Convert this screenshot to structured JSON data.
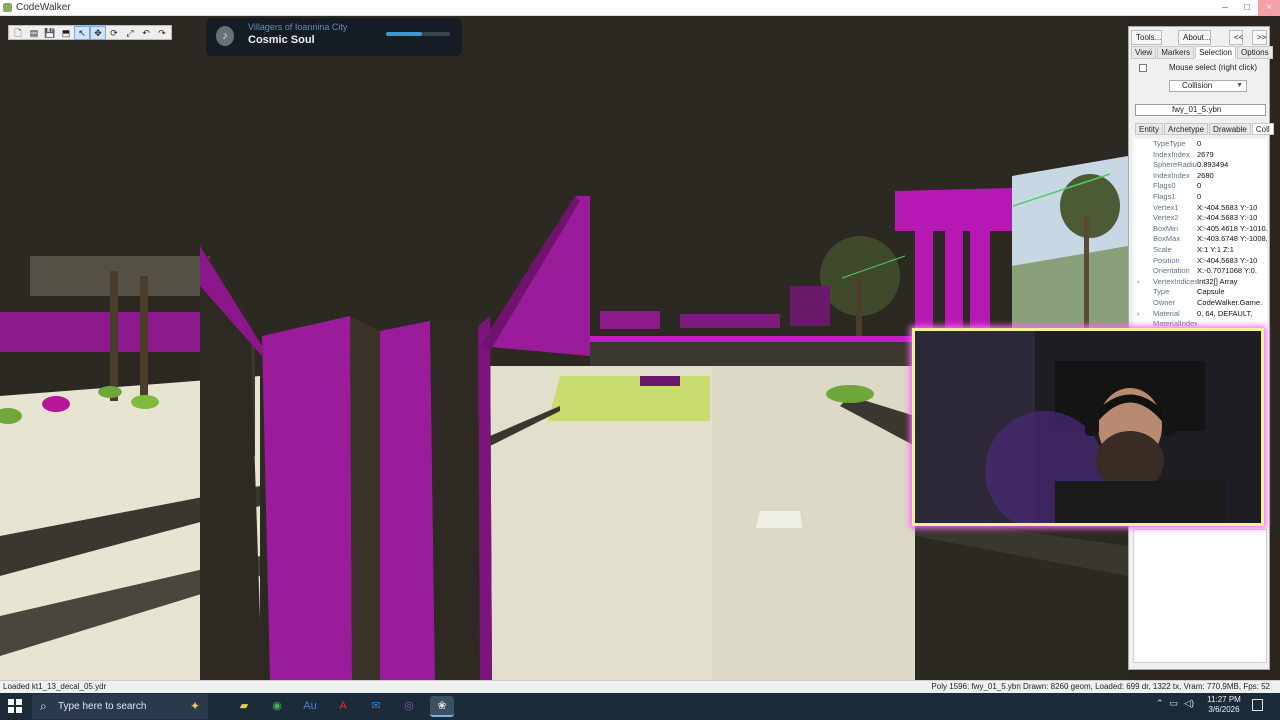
{
  "window": {
    "title": "CodeWalker",
    "controls": [
      "–",
      "□",
      "×"
    ]
  },
  "toolbar": {
    "buttons": [
      {
        "name": "new-button",
        "glyph": "🗋"
      },
      {
        "name": "open-button",
        "glyph": "▤"
      },
      {
        "name": "save-button",
        "glyph": "💾"
      },
      {
        "name": "save-all-button",
        "glyph": "⬒"
      },
      {
        "name": "select-tool-button",
        "glyph": "↖"
      },
      {
        "name": "move-tool-button",
        "glyph": "✥"
      },
      {
        "name": "rotate-tool-button",
        "glyph": "⟳"
      },
      {
        "name": "scale-tool-button",
        "glyph": "⤢"
      },
      {
        "name": "undo-button",
        "glyph": "↶"
      },
      {
        "name": "redo-button",
        "glyph": "↷"
      }
    ]
  },
  "now_playing": {
    "artist": "Villagers of Ioannina City",
    "title": "Cosmic Soul",
    "progress": 0.56
  },
  "panel": {
    "buttons": {
      "tools": "Tools...",
      "about": "About...",
      "collapse": "<<",
      "expand": ">>"
    },
    "tabs": [
      "View",
      "Markers",
      "Selection",
      "Options"
    ],
    "active_tab": "Selection",
    "mouse_select_label": "Mouse select (right click)",
    "mode_select_value": "Collision",
    "selected_file": "fwy_01_5.ybn",
    "subtabs": [
      "Entity",
      "Archetype",
      "Drawable",
      "Coll"
    ],
    "active_subtab": "Coll",
    "properties": [
      {
        "key": "TypeType",
        "value": "0"
      },
      {
        "key": "IndexIndex",
        "value": "2679"
      },
      {
        "key": "SphereRadius",
        "value": "0.893494"
      },
      {
        "key": "IndexIndex",
        "value": "2680"
      },
      {
        "key": "Flags0",
        "value": "0"
      },
      {
        "key": "Flags1",
        "value": "0"
      },
      {
        "key": "Vertex1",
        "value": "X:-404.5683 Y:-10"
      },
      {
        "key": "Vertex2",
        "value": "X:-404.5683 Y:-10"
      },
      {
        "key": "BoxMin",
        "value": "X:-405.4618 Y:-1010."
      },
      {
        "key": "BoxMax",
        "value": "X:-403.6748 Y:-1008."
      },
      {
        "key": "Scale",
        "value": "X:1 Y:1 Z:1"
      },
      {
        "key": "Position",
        "value": "X:-404.5683 Y:-10"
      },
      {
        "key": "Orientation",
        "value": "X:-0.7071068 Y:0."
      },
      {
        "key": "VertexIndices",
        "value": "Int32[] Array",
        "expandable": true
      },
      {
        "key": "Type",
        "value": "Capsule"
      },
      {
        "key": "Owner",
        "value": "CodeWalker.Game."
      },
      {
        "key": "Material",
        "value": "0, 64, DEFAULT,",
        "expandable": true
      },
      {
        "key": "MaterialIndex",
        "value": ""
      }
    ]
  },
  "status": {
    "left": "Loaded kt1_13_decal_05.ydr",
    "right": "Poly 1596: fwy_01_5.ybn   Drawn: 8260 geom, Loaded: 699 dr, 1322 tx, Vram: 770.9MB, Fps: 52"
  },
  "taskbar": {
    "search_placeholder": "Type here to search",
    "time": "11:27 PM",
    "date": "3/6/2026",
    "pinned_apps": [
      {
        "name": "file-explorer",
        "glyph": "▰",
        "color": "#f2c94c"
      },
      {
        "name": "chrome",
        "glyph": "◉",
        "color": "#4caf50"
      },
      {
        "name": "audition",
        "glyph": "Au",
        "color": "#4a7fd1"
      },
      {
        "name": "acrobat",
        "glyph": "A",
        "color": "#d32f2f"
      },
      {
        "name": "outlook",
        "glyph": "✉",
        "color": "#1e88e5"
      },
      {
        "name": "obs",
        "glyph": "◎",
        "color": "#7e57c2"
      },
      {
        "name": "codewalker",
        "glyph": "❀",
        "color": "#e0e0e0"
      }
    ]
  }
}
